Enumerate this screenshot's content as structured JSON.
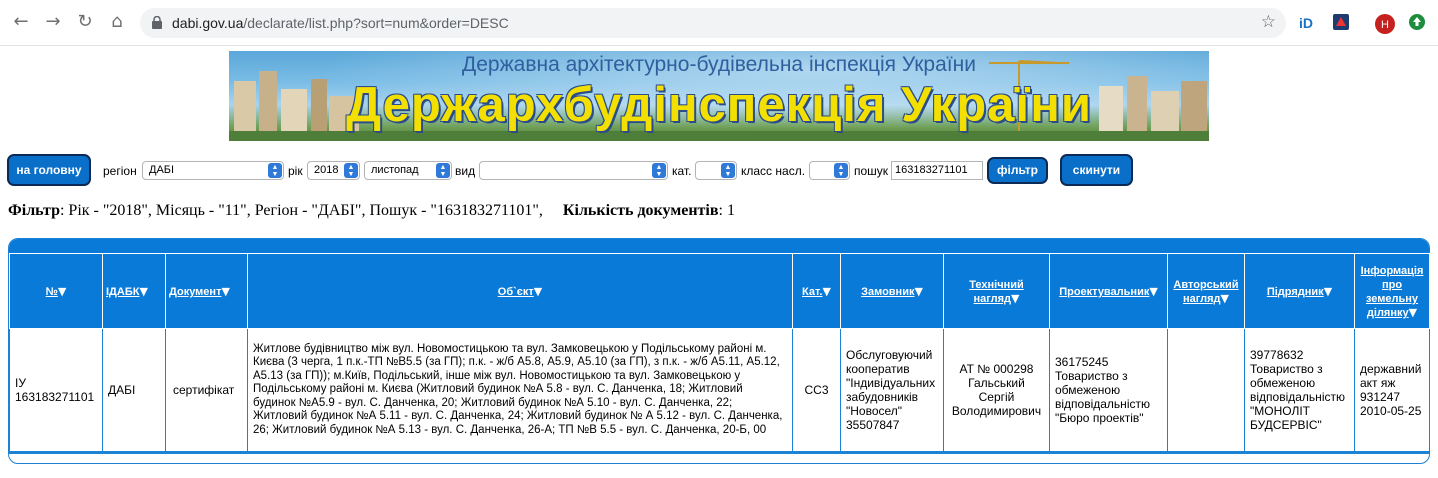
{
  "browser": {
    "url_host": "dabi.gov.ua",
    "url_path": "/declarate/list.php?sort=num&order=DESC",
    "profile_initial": "H"
  },
  "banner": {
    "line1": "Державна архітектурно-будівельна інспекція України",
    "line2": "Держархбудінспекція України"
  },
  "filter": {
    "home_button": "на головну",
    "region_label": "регіон",
    "region_value": "ДАБІ",
    "year_label": "рік",
    "year_value": "2018",
    "month_value": "листопад",
    "type_label": "вид",
    "type_value": "",
    "category_label": "кат.",
    "class_label": "класс насл.",
    "search_label": "пошук",
    "search_value": "163183271101",
    "filter_button": "фільтр",
    "reset_button": "скинути"
  },
  "summary": {
    "filter_label": "Фільтр",
    "filter_text": ": Рік - \"2018\", Місяць - \"11\", Регіон - \"ДАБІ\", Пошук - \"163183271101\",",
    "count_label": "Кількість документів",
    "count_text": ": 1"
  },
  "table": {
    "headers": [
      "№",
      "ІДАБК",
      "Документ",
      "Об`єкт",
      "Кат.",
      "Замовник",
      "Технічний нагляд",
      "Проектувальник",
      "Авторський нагляд",
      "Підрядник",
      "Інформація про земельну ділянку"
    ],
    "rows": [
      {
        "num": "ІУ 163183271101",
        "idabk": "ДАБІ",
        "doc": "сертифікат",
        "object": "Житлове будівництво між вул. Новомостицькою та вул. Замковецькою у Подільському районі м. Києва (3 черга, 1 п.к.-ТП №В5.5 (за ГП); п.к. - ж/б А5.8, А5.9, А5.10 (за ГП), з п.к. - ж/б А5.11, А5.12, А5.13 (за ГП)); м.Київ, Подільський, інше між вул. Новомостицькою та вул. Замковецькою у Подільському районі м. Києва (Житловий будинок №А 5.8 - вул. С. Данченка, 18; Житловий будинок №А5.9 - вул. С. Данченка, 20; Житловий будинок №А 5.10 - вул. С. Данченка, 22; Житловий будинок №А 5.11 - вул. С. Данченка, 24; Житловий будинок № А 5.12 - вул. С. Данченка, 26; Житловий будинок №А 5.13 - вул. С. Данченка, 26-А; ТП №В 5.5 - вул. С. Данченка, 20-Б, 00",
        "cat": "СС3",
        "customer": "Обслуговуючий кооператив \"Індивідуальних забудовників \"Новосел\" 35507847",
        "tech": "АТ № 000298 Гальський Сергій Володимирович",
        "designer": "36175245 Товариство з обмеженою відповідальністю \"Бюро проектів\"",
        "author": "",
        "contractor": "39778632 Товариство з обмеженою відповідальністю \"МОНОЛІТ БУДСЕРВІС\"",
        "land": "державний акт яж 931247 2010-05-25"
      }
    ]
  },
  "colors": {
    "accent": "#0a7ad9",
    "button": "#0a6fc9",
    "banner_text": "#f3e000"
  }
}
